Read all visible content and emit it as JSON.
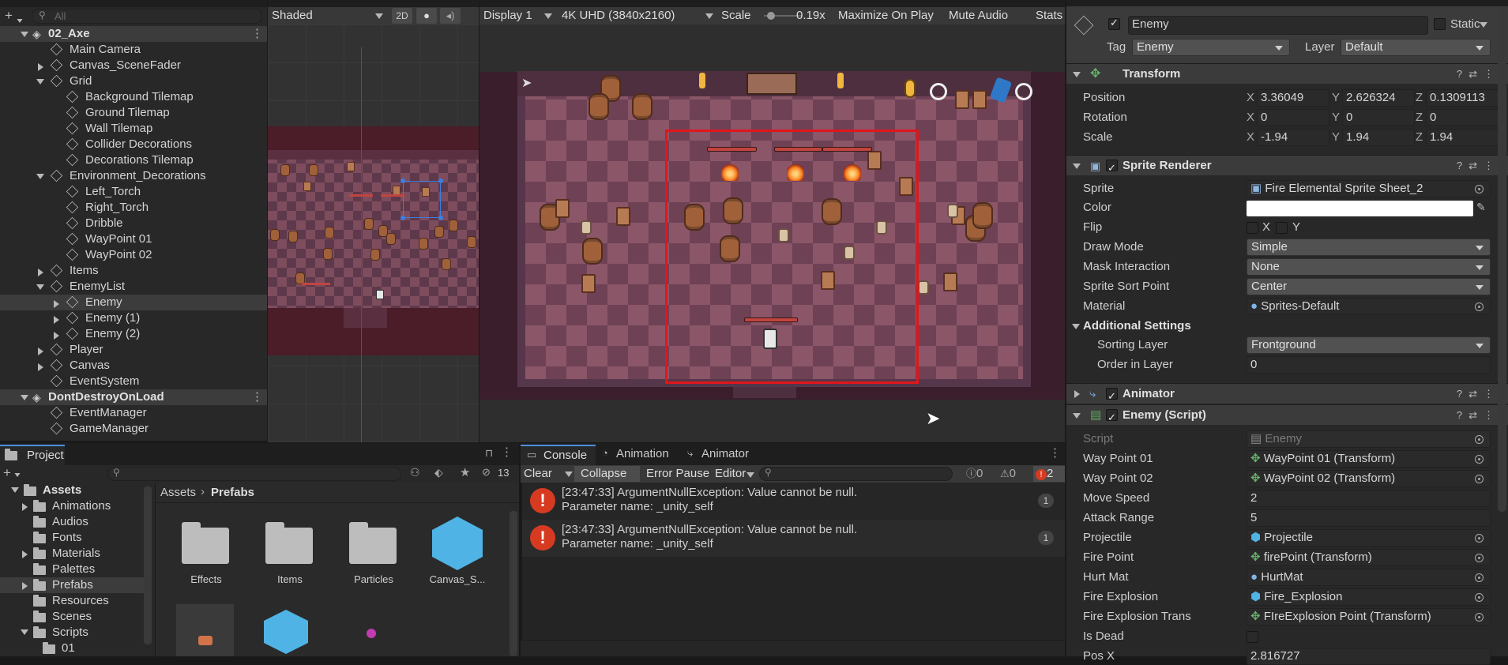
{
  "hierarchy": {
    "search_placeholder": "All",
    "rows": [
      {
        "label": "02_Axe",
        "scene": true
      },
      {
        "label": "Main Camera"
      },
      {
        "label": "Canvas_SceneFader"
      },
      {
        "label": "Grid"
      },
      {
        "label": "Background Tilemap"
      },
      {
        "label": "Ground Tilemap"
      },
      {
        "label": "Wall Tilemap"
      },
      {
        "label": "Collider Decorations"
      },
      {
        "label": "Decorations Tilemap"
      },
      {
        "label": "Environment_Decorations"
      },
      {
        "label": "Left_Torch"
      },
      {
        "label": "Right_Torch"
      },
      {
        "label": "Dribble"
      },
      {
        "label": "WayPoint 01"
      },
      {
        "label": "WayPoint 02"
      },
      {
        "label": "Items"
      },
      {
        "label": "EnemyList"
      },
      {
        "label": "Enemy"
      },
      {
        "label": "Enemy (1)"
      },
      {
        "label": "Enemy (2)"
      },
      {
        "label": "Player"
      },
      {
        "label": "Canvas"
      },
      {
        "label": "EventSystem"
      },
      {
        "label": "DontDestroyOnLoad",
        "scene": true
      },
      {
        "label": "EventManager"
      },
      {
        "label": "GameManager"
      }
    ]
  },
  "scene": {
    "shading": "Shaded",
    "mode_2d": "2D"
  },
  "game": {
    "display": "Display 1",
    "resolution": "4K UHD (3840x2160)",
    "scale_label": "Scale",
    "scale_value": "0.19x",
    "scale_fraction": 0.1,
    "maximize": "Maximize On Play",
    "mute": "Mute Audio",
    "stats": "Stats"
  },
  "inspector": {
    "object_name": "Enemy",
    "static_label": "Static",
    "tag_label": "Tag",
    "tag": "Enemy",
    "layer_label": "Layer",
    "layer": "Default",
    "transform": {
      "title": "Transform",
      "rows": [
        {
          "label": "Position",
          "x": "3.36049",
          "y": "2.626324",
          "z": "0.1309113"
        },
        {
          "label": "Rotation",
          "x": "0",
          "y": "0",
          "z": "0"
        },
        {
          "label": "Scale",
          "x": "-1.94",
          "y": "1.94",
          "z": "1.94"
        }
      ],
      "ax": "X",
      "ay": "Y",
      "az": "Z"
    },
    "sprite_renderer": {
      "title": "Sprite Renderer",
      "sprite_label": "Sprite",
      "sprite": "Fire Elemental Sprite Sheet_2",
      "color_label": "Color",
      "color": "#ffffff",
      "flip_label": "Flip",
      "flip_x": "X",
      "flip_y": "Y",
      "draw_mode_label": "Draw Mode",
      "draw_mode": "Simple",
      "mask_label": "Mask Interaction",
      "mask": "None",
      "sort_point_label": "Sprite Sort Point",
      "sort_point": "Center",
      "material_label": "Material",
      "material": "Sprites-Default",
      "additional": "Additional Settings",
      "sorting_layer_label": "Sorting Layer",
      "sorting_layer": "Frontground",
      "order_label": "Order in Layer",
      "order": "0"
    },
    "animator": {
      "title": "Animator"
    },
    "enemy_script": {
      "title": "Enemy (Script)",
      "rows": [
        {
          "label": "Script",
          "value": "Enemy",
          "kind": "script"
        },
        {
          "label": "Way Point 01",
          "value": "WayPoint 01 (Transform)",
          "kind": "transform"
        },
        {
          "label": "Way Point 02",
          "value": "WayPoint 02 (Transform)",
          "kind": "transform"
        },
        {
          "label": "Move Speed",
          "value": "2",
          "kind": "num"
        },
        {
          "label": "Attack Range",
          "value": "5",
          "kind": "num"
        },
        {
          "label": "Projectile",
          "value": "Projectile",
          "kind": "prefab"
        },
        {
          "label": "Fire Point",
          "value": "firePoint (Transform)",
          "kind": "transform"
        },
        {
          "label": "Hurt Mat",
          "value": "HurtMat",
          "kind": "material"
        },
        {
          "label": "Fire Explosion",
          "value": "Fire_Explosion",
          "kind": "prefab"
        },
        {
          "label": "Fire Explosion Trans",
          "value": "FIreExplosion Point (Transform)",
          "kind": "transform"
        },
        {
          "label": "Is Dead",
          "value": "",
          "kind": "bool"
        },
        {
          "label": "Pos X",
          "value": "2.816727",
          "kind": "num"
        }
      ]
    }
  },
  "project": {
    "tab": "Project",
    "tree": [
      {
        "label": "Assets",
        "bold": true
      },
      {
        "label": "Animations"
      },
      {
        "label": "Audios"
      },
      {
        "label": "Fonts"
      },
      {
        "label": "Materials"
      },
      {
        "label": "Palettes"
      },
      {
        "label": "Prefabs"
      },
      {
        "label": "Resources"
      },
      {
        "label": "Scenes"
      },
      {
        "label": "Scripts"
      },
      {
        "label": "01"
      }
    ],
    "breadcrumb": [
      "Assets",
      "Prefabs"
    ],
    "items": [
      {
        "label": "Effects"
      },
      {
        "label": "Items"
      },
      {
        "label": "Particles"
      },
      {
        "label": "Canvas_S..."
      }
    ],
    "hidden_count": "13"
  },
  "console": {
    "tabs": [
      "Console",
      "Animation",
      "Animator"
    ],
    "clear": "Clear",
    "collapse": "Collapse",
    "error_pause": "Error Pause",
    "editor": "Editor",
    "count_info": "0",
    "count_warn": "0",
    "count_err": "2",
    "logs": [
      {
        "line1": "[23:47:33] ArgumentNullException: Value cannot be null.",
        "line2": "Parameter name: _unity_self",
        "count": "1"
      },
      {
        "line1": "[23:47:33] ArgumentNullException: Value cannot be null.",
        "line2": "Parameter name: _unity_self",
        "count": "1"
      }
    ]
  }
}
